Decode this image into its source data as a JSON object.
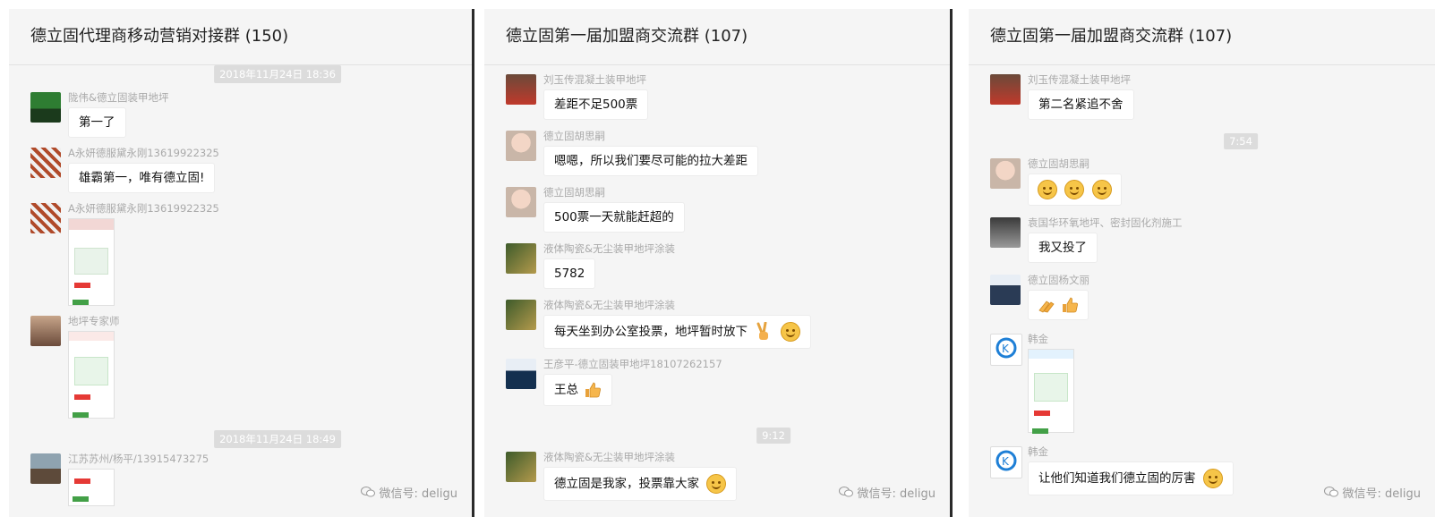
{
  "watermark": "微信号: deligu",
  "panels": [
    {
      "title": "德立固代理商移动营销对接群 (150)",
      "time_1": "2018年11月24日 18:36",
      "time_2": "2018年11月24日 18:49",
      "msgs": [
        {
          "name": "陇伟&德立固装甲地坪",
          "text": "第一了"
        },
        {
          "name": "A永妍德服黛永刚13619922325",
          "text": "雄霸第一，唯有德立固!"
        },
        {
          "name": "A永妍德服黛永刚13619922325",
          "text": ""
        },
        {
          "name": "地坪专家师",
          "text": ""
        },
        {
          "name": "江苏苏州/杨平/13915473275",
          "text": ""
        }
      ]
    },
    {
      "title": "德立固第一届加盟商交流群 (107)",
      "time_1": "9:12",
      "msgs": [
        {
          "name": "刘玉传混凝土装甲地坪",
          "text": "差距不足500票"
        },
        {
          "name": "德立固胡思嗣",
          "text": "嗯嗯，所以我们要尽可能的拉大差距"
        },
        {
          "name": "德立固胡思嗣",
          "text": "500票一天就能赶超的"
        },
        {
          "name": "液体陶瓷&无尘装甲地坪涂装",
          "text": "5782"
        },
        {
          "name": "液体陶瓷&无尘装甲地坪涂装",
          "text": "每天坐到办公室投票，地坪暂时放下"
        },
        {
          "name": "王彦平-德立固装甲地坪18107262157",
          "text": "王总"
        },
        {
          "name": "液体陶瓷&无尘装甲地坪涂装",
          "text": "德立固是我家，投票靠大家"
        }
      ]
    },
    {
      "title": "德立固第一届加盟商交流群 (107)",
      "time_1": "7:54",
      "msgs": [
        {
          "name": "刘玉传混凝土装甲地坪",
          "text": "第二名紧追不舍"
        },
        {
          "name": "德立固胡思嗣",
          "text": ""
        },
        {
          "name": "袁国华环氧地坪、密封固化剂施工",
          "text": "我又投了"
        },
        {
          "name": "德立固杨文丽",
          "text": ""
        },
        {
          "name": "韩金",
          "text": ""
        },
        {
          "name": "韩金",
          "text": "让他们知道我们德立固的厉害"
        }
      ]
    }
  ],
  "colors": {
    "panel_bg": "#f5f5f5",
    "bubble_bg": "#ffffff",
    "time_badge": "#dcdcdc",
    "name_text": "#aaaaaa"
  },
  "icons": [
    "wechat-icon",
    "thumbs-up-icon",
    "victory-hand-icon",
    "grin-emoji-icon",
    "smile-emoji-icon",
    "clap-icon"
  ]
}
